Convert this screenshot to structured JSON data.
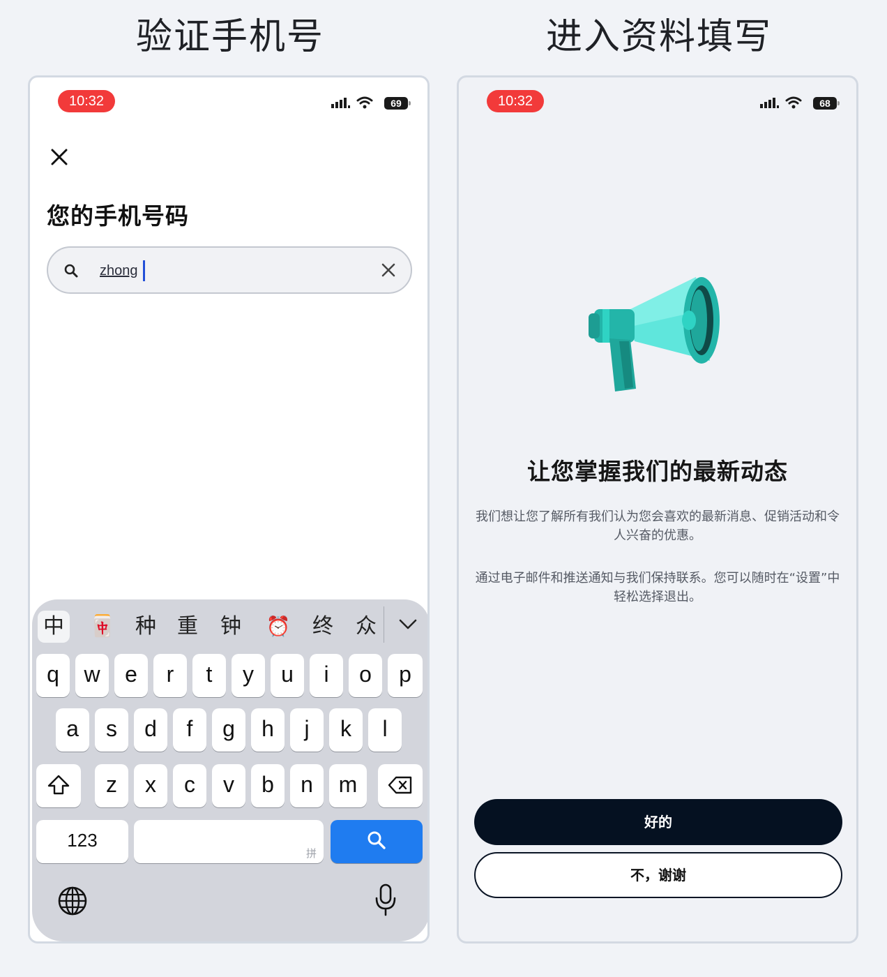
{
  "columns": {
    "left_title": "验证手机号",
    "right_title": "进入资料填写"
  },
  "status_bar": {
    "left_time": "10:32",
    "left_battery": "69",
    "right_time": "10:32",
    "right_battery": "68",
    "time_badge_color": "#f23a3a"
  },
  "phone_screen": {
    "title": "您的手机号码",
    "search_value": "zhong",
    "icons": [
      "close-icon",
      "search-icon",
      "clear-icon"
    ]
  },
  "keyboard": {
    "candidates": [
      "中",
      "🀄",
      "种",
      "重",
      "钟",
      "⏰",
      "终",
      "众"
    ],
    "rows": [
      [
        "q",
        "w",
        "e",
        "r",
        "t",
        "y",
        "u",
        "i",
        "o",
        "p"
      ],
      [
        "a",
        "s",
        "d",
        "f",
        "g",
        "h",
        "j",
        "k",
        "l"
      ],
      [
        "z",
        "x",
        "c",
        "v",
        "b",
        "n",
        "m"
      ]
    ],
    "numbers_key": "123",
    "space_hint": "拼",
    "search_key_color": "#1f7cf0",
    "icons": [
      "shift-icon",
      "backspace-icon",
      "search-icon",
      "globe-icon",
      "microphone-icon",
      "chevron-down-icon"
    ]
  },
  "promo_screen": {
    "title": "让您掌握我们的最新动态",
    "paragraph1": "我们想让您了解所有我们认为您会喜欢的最新消息、促销活动和令人兴奋的优惠。",
    "paragraph2": "通过电子邮件和推送通知与我们保持联系。您可以随时在“设置”中轻松选择退出。",
    "ok_button": "好的",
    "decline_button": "不，谢谢",
    "illustration": "megaphone-icon",
    "accent_color": "#2ed1c0"
  }
}
